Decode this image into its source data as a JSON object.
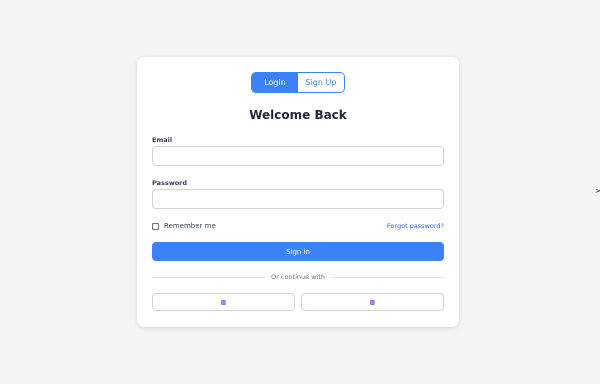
{
  "tabs": [
    {
      "label": "Login",
      "active": true
    },
    {
      "label": "Sign Up",
      "active": false
    }
  ],
  "title": "Welcome Back",
  "email": {
    "label": "Email",
    "value": "",
    "placeholder": ""
  },
  "password": {
    "label": "Password",
    "value": "",
    "placeholder": ""
  },
  "remember_label": "Remember me",
  "forgot_label": "Forgot password?",
  "signin_label": "Sign in",
  "divider_text": "Or continue with",
  "social_buttons": [
    {
      "icon": "broken-image-icon"
    },
    {
      "icon": "broken-image-icon"
    }
  ],
  "edge_char": ">",
  "colors": {
    "accent": "#3b82f6",
    "link": "#2563eb",
    "background": "#f3f4f6"
  }
}
